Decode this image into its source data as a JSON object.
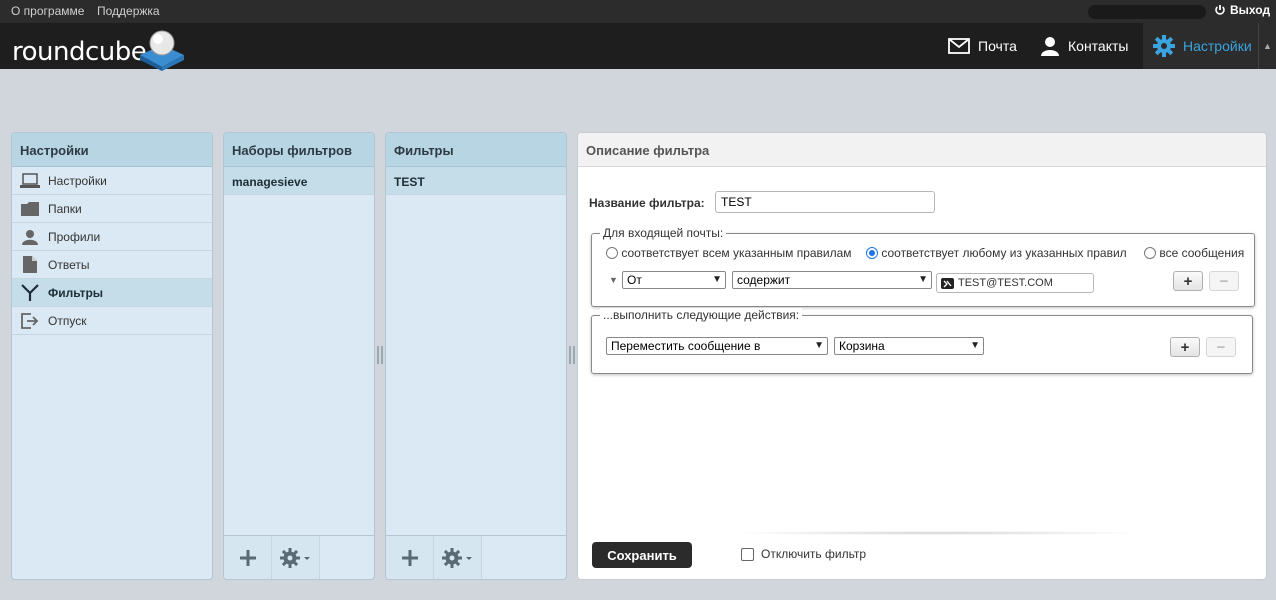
{
  "topbar": {
    "about": "О программе",
    "support": "Поддержка",
    "logout": "Выход"
  },
  "header": {
    "logo": "roundcube",
    "nav": {
      "mail": "Почта",
      "contacts": "Контакты",
      "settings": "Настройки"
    },
    "active_color": "#3ba4e0"
  },
  "settings_panel": {
    "title": "Настройки",
    "items": [
      {
        "label": "Настройки",
        "icon": "laptop-icon"
      },
      {
        "label": "Папки",
        "icon": "folder-icon"
      },
      {
        "label": "Профили",
        "icon": "user-icon"
      },
      {
        "label": "Ответы",
        "icon": "document-icon"
      },
      {
        "label": "Фильтры",
        "icon": "filter-icon",
        "selected": true
      },
      {
        "label": "Отпуск",
        "icon": "exit-icon"
      }
    ]
  },
  "filtersets_panel": {
    "title": "Наборы фильтров",
    "items": [
      "managesieve"
    ]
  },
  "filters_panel": {
    "title": "Фильтры",
    "items": [
      "TEST"
    ]
  },
  "filter_form": {
    "title": "Описание фильтра",
    "name_label": "Название фильтра:",
    "name_value": "TEST",
    "rules_legend": "Для входящей почты:",
    "match_options": {
      "all": "соответствует всем указанным правилам",
      "any": "соответствует любому из указанных правил",
      "every": "все сообщения",
      "selected": "any"
    },
    "rule": {
      "header": "От",
      "operator": "содержит",
      "value": "TEST@TEST.COM"
    },
    "actions_legend": "...выполнить следующие действия:",
    "action": {
      "type": "Переместить сообщение в",
      "target": "Корзина"
    },
    "plus": "+",
    "minus": "−",
    "save_label": "Сохранить",
    "disable_label": "Отключить фильтр"
  }
}
